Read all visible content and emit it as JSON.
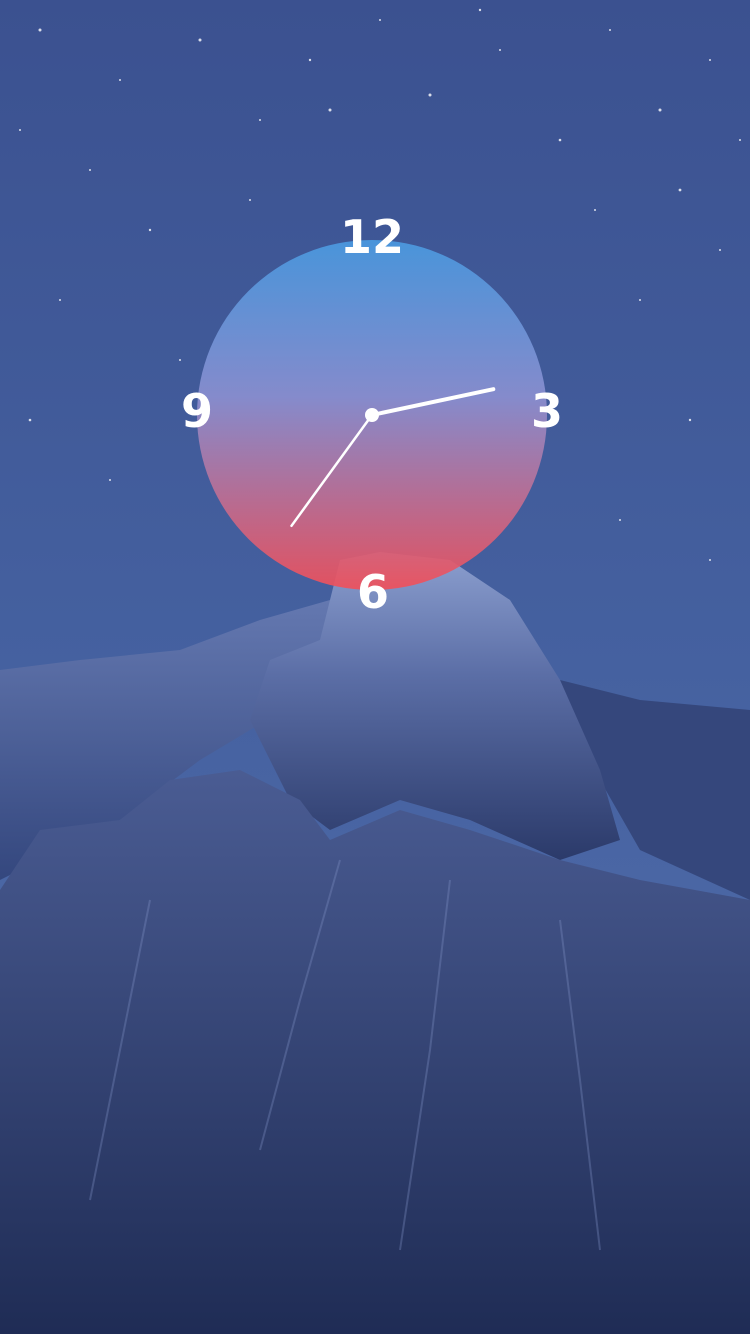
{
  "clock": {
    "numerals": {
      "twelve": "12",
      "three": "3",
      "six": "6",
      "nine": "9"
    },
    "time": {
      "hour": 2,
      "minute": 36
    },
    "face_gradient": {
      "top": "#4a9ae0",
      "middle": "#8b8fd0",
      "bottom": "#f0505a"
    },
    "hand_color": "#ffffff"
  },
  "wallpaper": {
    "subject": "mountain-night-sky",
    "sky_color": "#3f5897",
    "rock_color": "#5a6fa8"
  }
}
